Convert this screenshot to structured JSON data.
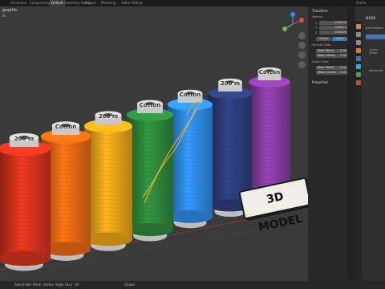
{
  "workspace_tabs": [
    {
      "label": "Animation"
    },
    {
      "label": "Compositing"
    },
    {
      "label": "Default",
      "active": true
    },
    {
      "label": "Geometry Nodes"
    },
    {
      "label": "Layout"
    },
    {
      "label": "Modeling"
    },
    {
      "label": "Video Editing"
    }
  ],
  "header_right": {
    "scene": "Scene"
  },
  "viewport": {
    "info_line1": "graphic",
    "info_line2": "n",
    "badge": "3D MODEL"
  },
  "spools": [
    {
      "name": "red",
      "label": "200 m",
      "color": "#d9341f"
    },
    {
      "name": "orange",
      "label": "Cotton",
      "color": "#ee6a14"
    },
    {
      "name": "yellow",
      "label": "200 m",
      "color": "#f0a618"
    },
    {
      "name": "green",
      "label": "Cotton",
      "color": "#2e8a3c"
    },
    {
      "name": "blue",
      "label": "Cotton",
      "color": "#2f8ee6"
    },
    {
      "name": "navy",
      "label": "200 m",
      "color": "#2e3e7c"
    },
    {
      "name": "purple",
      "label": "Cotton",
      "color": "#8b3fa6"
    }
  ],
  "npanel": {
    "transform_header": "Transform",
    "median_label": "Median:",
    "x_label": "X",
    "x_value": "0.00000",
    "y_label": "Y",
    "y_value": "0.00014",
    "z_label": "Z",
    "z_value": "0.00000",
    "global_btn": "Global",
    "local_btn": "Local",
    "vertex_data_label": "Vertices Data:",
    "mean_bevel_label": "Mean Bevel",
    "mean_bevel_value": "0.00",
    "mean_vertex_label": "Mean Vertex",
    "mean_vertex_value": "0.00",
    "edges_data_label": "Edges Data:",
    "mean_bevel2_value": "0.00",
    "mean_crease_label": "Mean Crease",
    "mean_crease_value": "0.00",
    "properties_header": "Properties"
  },
  "props": {
    "header": "MODE",
    "add_modifier": "Add Modifier",
    "levels_label": "Levels Viewp",
    "advanced_label": "Advanced"
  },
  "bottom_menu": [
    "Select",
    "Add",
    "Mesh",
    "Vertex",
    "Edge",
    "Face",
    "UV"
  ],
  "orientation": "Global",
  "colors": {
    "viewport_bg": "#3a3a3a",
    "accent": "#4772b3"
  }
}
